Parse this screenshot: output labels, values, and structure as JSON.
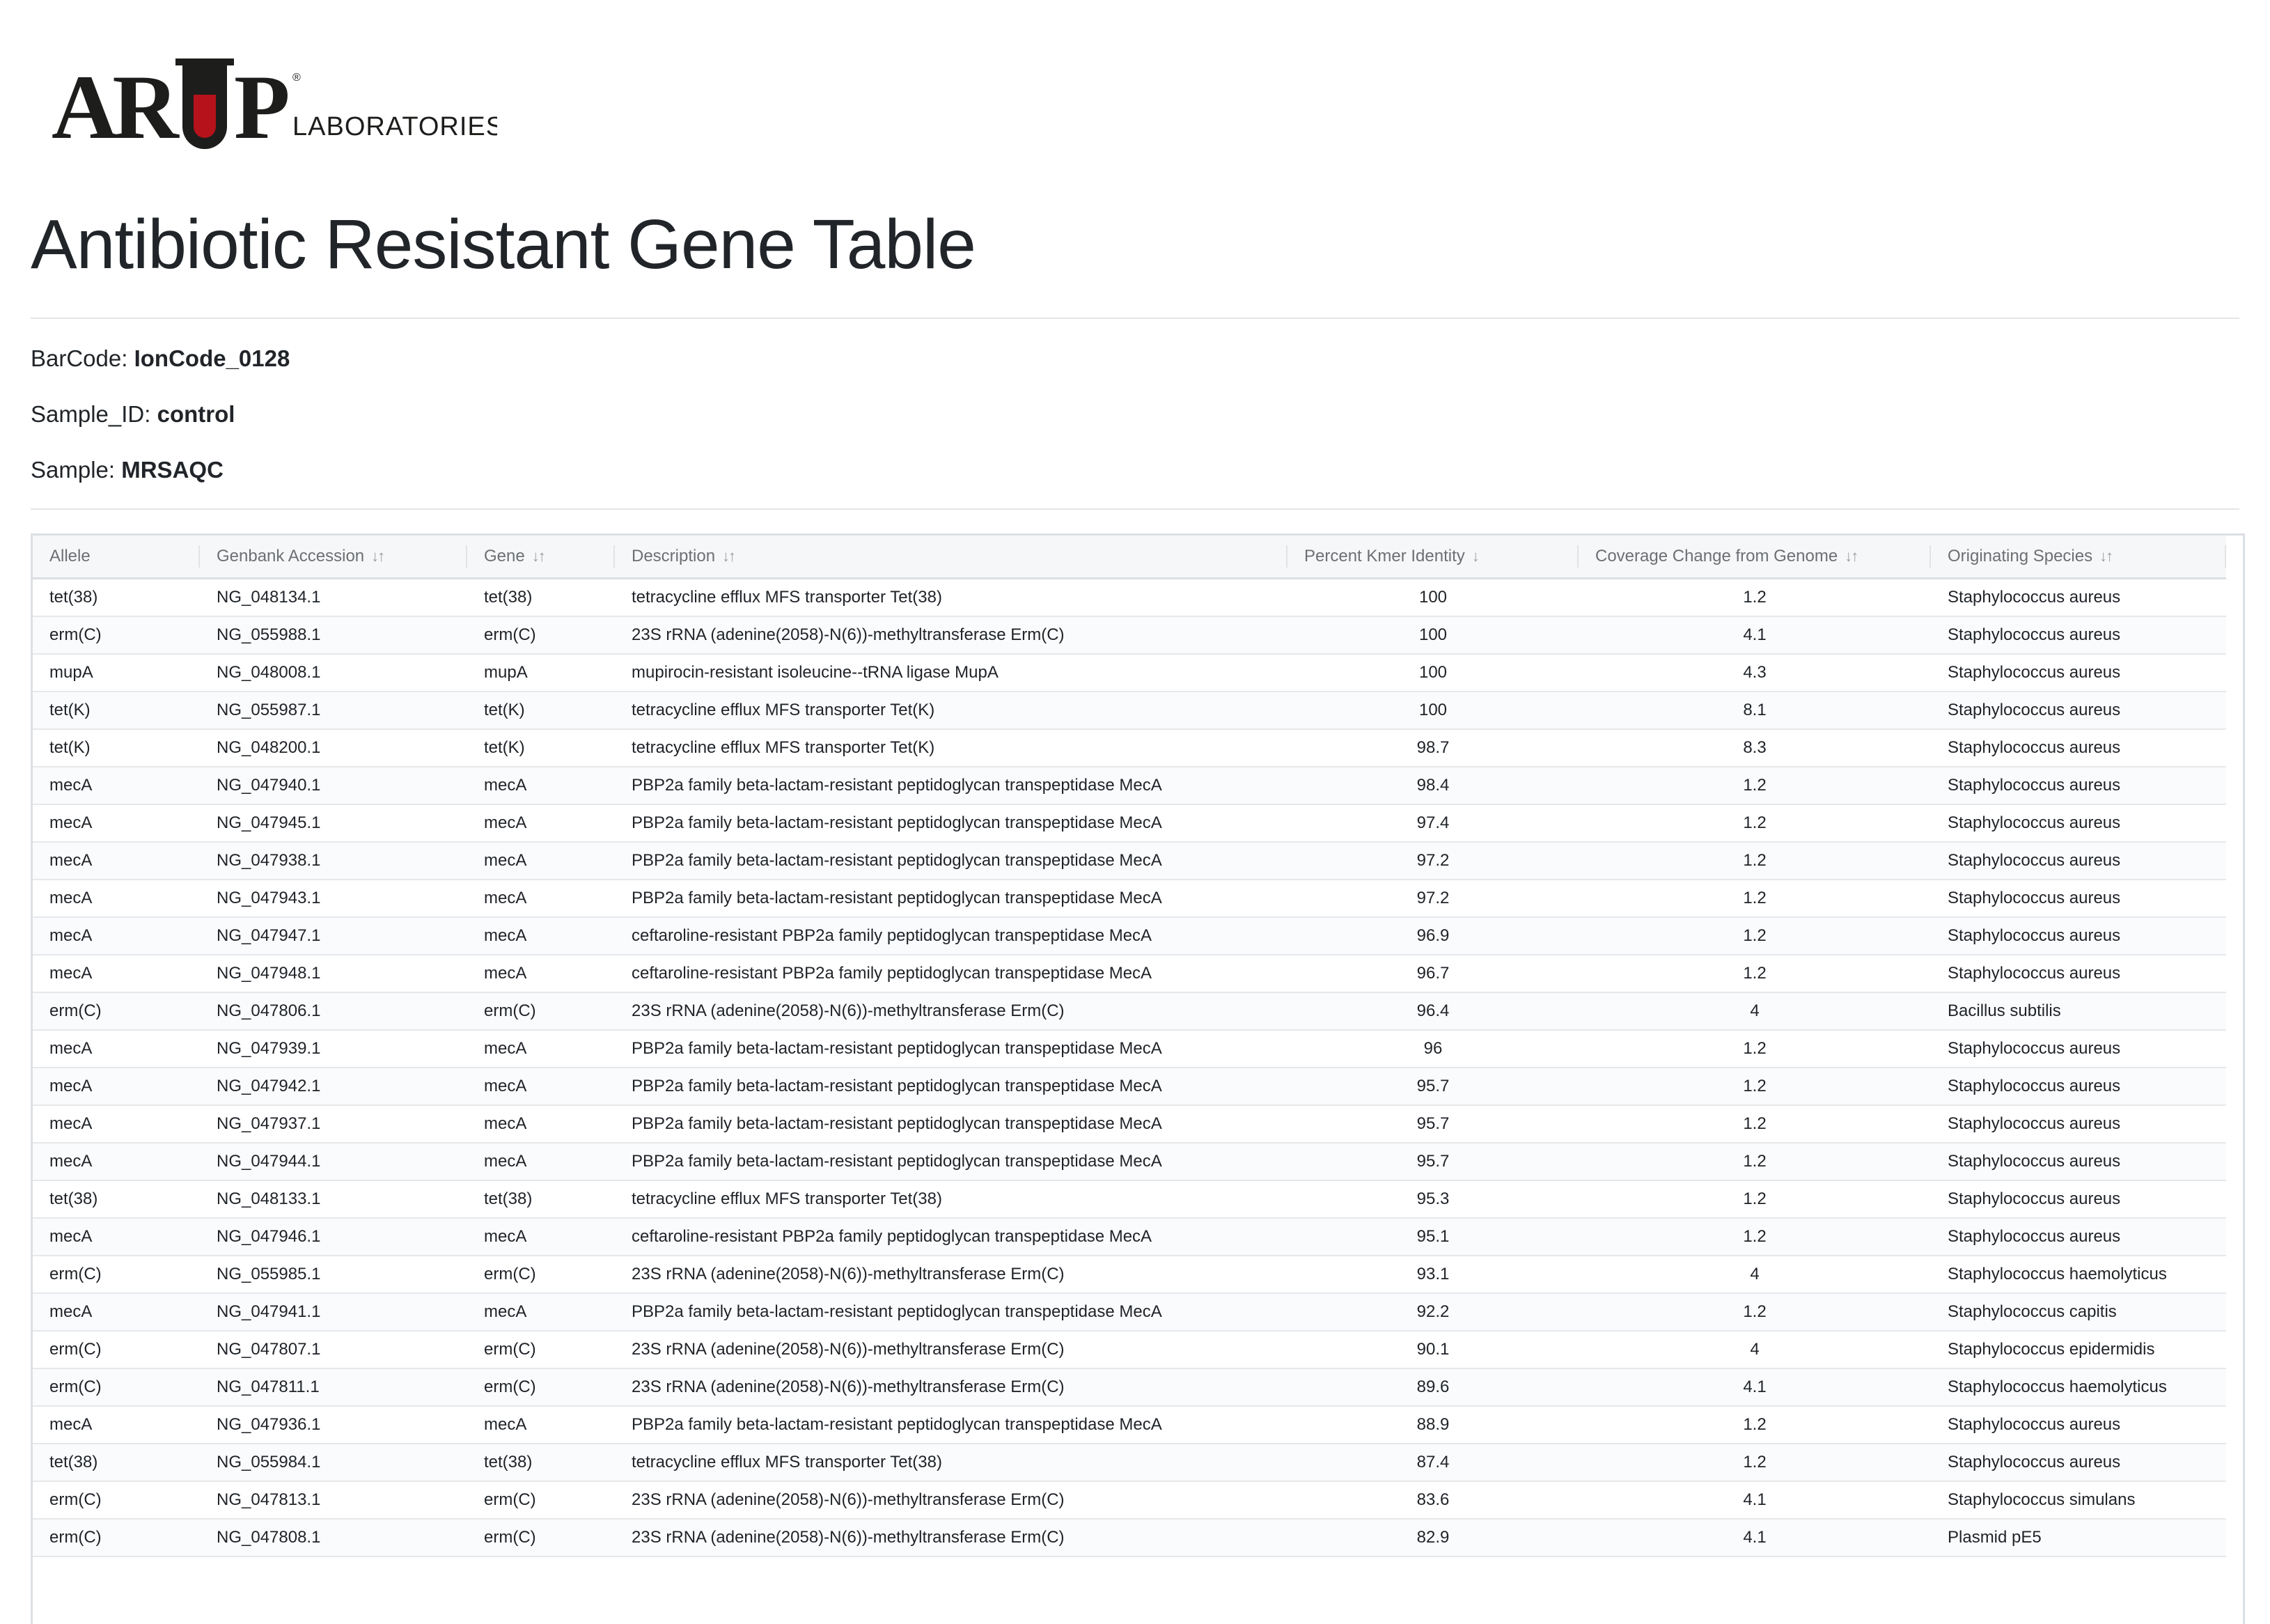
{
  "logo": {
    "wordmark": "ARUP",
    "sub": "LABORATORIES",
    "colors": {
      "dark": "#1d1d1b",
      "red": "#b5121b"
    }
  },
  "page": {
    "title": "Antibiotic Resistant Gene Table"
  },
  "meta": {
    "barcode_label": "BarCode: ",
    "barcode_value": "IonCode_0128",
    "sample_id_label": "Sample_ID: ",
    "sample_id_value": "control",
    "sample_label": "Sample: ",
    "sample_value": "MRSAQC"
  },
  "table": {
    "columns": [
      {
        "label": "Allele",
        "sort_icon": ""
      },
      {
        "label": "Genbank Accession",
        "sort_icon": "↓↑"
      },
      {
        "label": "Gene",
        "sort_icon": "↓↑"
      },
      {
        "label": "Description",
        "sort_icon": "↓↑"
      },
      {
        "label": "Percent Kmer Identity",
        "sort_icon": "↓"
      },
      {
        "label": "Coverage Change from Genome",
        "sort_icon": "↓↑"
      },
      {
        "label": "Originating Species",
        "sort_icon": "↓↑"
      }
    ],
    "rows": [
      [
        "tet(38)",
        "NG_048134.1",
        "tet(38)",
        "tetracycline efflux MFS transporter Tet(38)",
        "100",
        "1.2",
        "Staphylococcus aureus"
      ],
      [
        "erm(C)",
        "NG_055988.1",
        "erm(C)",
        "23S rRNA (adenine(2058)-N(6))-methyltransferase Erm(C)",
        "100",
        "4.1",
        "Staphylococcus aureus"
      ],
      [
        "mupA",
        "NG_048008.1",
        "mupA",
        "mupirocin-resistant isoleucine--tRNA ligase MupA",
        "100",
        "4.3",
        "Staphylococcus aureus"
      ],
      [
        "tet(K)",
        "NG_055987.1",
        "tet(K)",
        "tetracycline efflux MFS transporter Tet(K)",
        "100",
        "8.1",
        "Staphylococcus aureus"
      ],
      [
        "tet(K)",
        "NG_048200.1",
        "tet(K)",
        "tetracycline efflux MFS transporter Tet(K)",
        "98.7",
        "8.3",
        "Staphylococcus aureus"
      ],
      [
        "mecA",
        "NG_047940.1",
        "mecA",
        "PBP2a family beta-lactam-resistant peptidoglycan transpeptidase MecA",
        "98.4",
        "1.2",
        "Staphylococcus aureus"
      ],
      [
        "mecA",
        "NG_047945.1",
        "mecA",
        "PBP2a family beta-lactam-resistant peptidoglycan transpeptidase MecA",
        "97.4",
        "1.2",
        "Staphylococcus aureus"
      ],
      [
        "mecA",
        "NG_047938.1",
        "mecA",
        "PBP2a family beta-lactam-resistant peptidoglycan transpeptidase MecA",
        "97.2",
        "1.2",
        "Staphylococcus aureus"
      ],
      [
        "mecA",
        "NG_047943.1",
        "mecA",
        "PBP2a family beta-lactam-resistant peptidoglycan transpeptidase MecA",
        "97.2",
        "1.2",
        "Staphylococcus aureus"
      ],
      [
        "mecA",
        "NG_047947.1",
        "mecA",
        "ceftaroline-resistant PBP2a family peptidoglycan transpeptidase MecA",
        "96.9",
        "1.2",
        "Staphylococcus aureus"
      ],
      [
        "mecA",
        "NG_047948.1",
        "mecA",
        "ceftaroline-resistant PBP2a family peptidoglycan transpeptidase MecA",
        "96.7",
        "1.2",
        "Staphylococcus aureus"
      ],
      [
        "erm(C)",
        "NG_047806.1",
        "erm(C)",
        "23S rRNA (adenine(2058)-N(6))-methyltransferase Erm(C)",
        "96.4",
        "4",
        "Bacillus subtilis"
      ],
      [
        "mecA",
        "NG_047939.1",
        "mecA",
        "PBP2a family beta-lactam-resistant peptidoglycan transpeptidase MecA",
        "96",
        "1.2",
        "Staphylococcus aureus"
      ],
      [
        "mecA",
        "NG_047942.1",
        "mecA",
        "PBP2a family beta-lactam-resistant peptidoglycan transpeptidase MecA",
        "95.7",
        "1.2",
        "Staphylococcus aureus"
      ],
      [
        "mecA",
        "NG_047937.1",
        "mecA",
        "PBP2a family beta-lactam-resistant peptidoglycan transpeptidase MecA",
        "95.7",
        "1.2",
        "Staphylococcus aureus"
      ],
      [
        "mecA",
        "NG_047944.1",
        "mecA",
        "PBP2a family beta-lactam-resistant peptidoglycan transpeptidase MecA",
        "95.7",
        "1.2",
        "Staphylococcus aureus"
      ],
      [
        "tet(38)",
        "NG_048133.1",
        "tet(38)",
        "tetracycline efflux MFS transporter Tet(38)",
        "95.3",
        "1.2",
        "Staphylococcus aureus"
      ],
      [
        "mecA",
        "NG_047946.1",
        "mecA",
        "ceftaroline-resistant PBP2a family peptidoglycan transpeptidase MecA",
        "95.1",
        "1.2",
        "Staphylococcus aureus"
      ],
      [
        "erm(C)",
        "NG_055985.1",
        "erm(C)",
        "23S rRNA (adenine(2058)-N(6))-methyltransferase Erm(C)",
        "93.1",
        "4",
        "Staphylococcus haemolyticus"
      ],
      [
        "mecA",
        "NG_047941.1",
        "mecA",
        "PBP2a family beta-lactam-resistant peptidoglycan transpeptidase MecA",
        "92.2",
        "1.2",
        "Staphylococcus capitis"
      ],
      [
        "erm(C)",
        "NG_047807.1",
        "erm(C)",
        "23S rRNA (adenine(2058)-N(6))-methyltransferase Erm(C)",
        "90.1",
        "4",
        "Staphylococcus epidermidis"
      ],
      [
        "erm(C)",
        "NG_047811.1",
        "erm(C)",
        "23S rRNA (adenine(2058)-N(6))-methyltransferase Erm(C)",
        "89.6",
        "4.1",
        "Staphylococcus haemolyticus"
      ],
      [
        "mecA",
        "NG_047936.1",
        "mecA",
        "PBP2a family beta-lactam-resistant peptidoglycan transpeptidase MecA",
        "88.9",
        "1.2",
        "Staphylococcus aureus"
      ],
      [
        "tet(38)",
        "NG_055984.1",
        "tet(38)",
        "tetracycline efflux MFS transporter Tet(38)",
        "87.4",
        "1.2",
        "Staphylococcus aureus"
      ],
      [
        "erm(C)",
        "NG_047813.1",
        "erm(C)",
        "23S rRNA (adenine(2058)-N(6))-methyltransferase Erm(C)",
        "83.6",
        "4.1",
        "Staphylococcus simulans"
      ],
      [
        "erm(C)",
        "NG_047808.1",
        "erm(C)",
        "23S rRNA (adenine(2058)-N(6))-methyltransferase Erm(C)",
        "82.9",
        "4.1",
        "Plasmid pE5"
      ]
    ]
  }
}
